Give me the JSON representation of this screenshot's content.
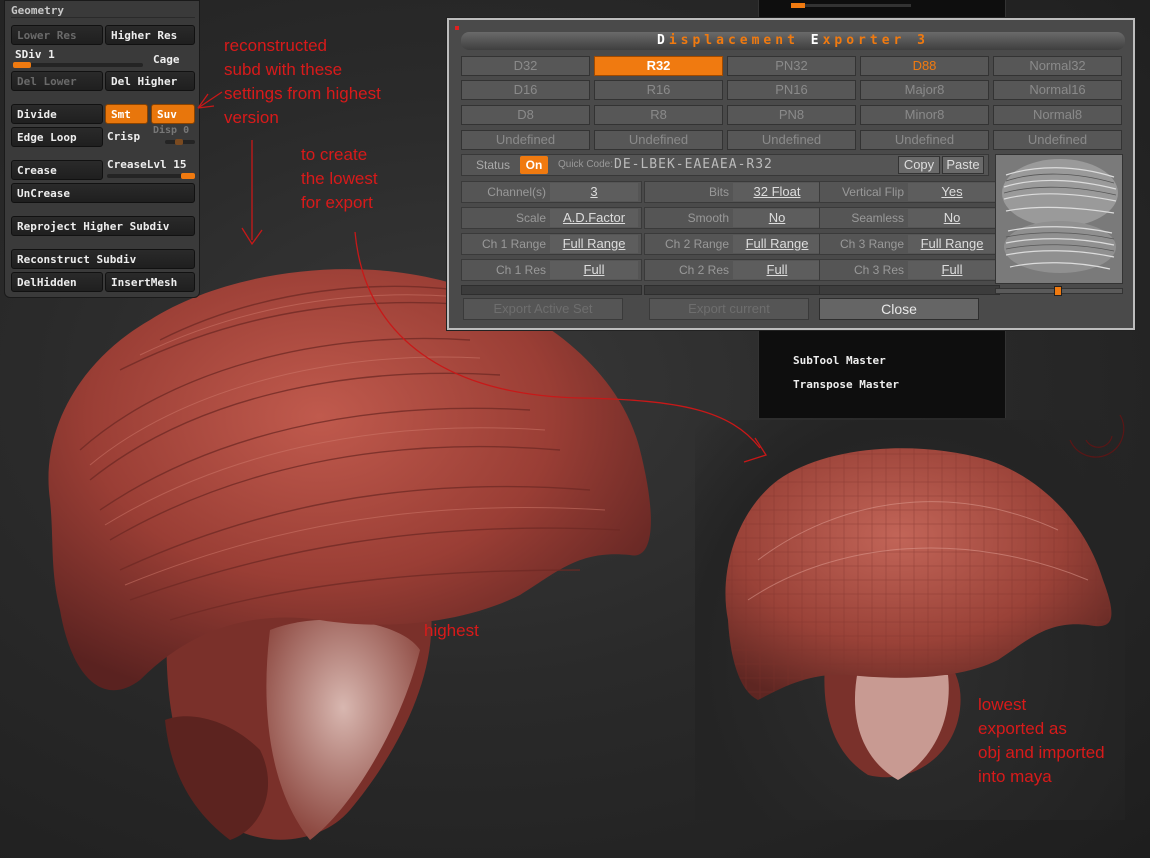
{
  "geometry": {
    "title": "Geometry",
    "lower_res": "Lower Res",
    "higher_res": "Higher Res",
    "sdiv_label": "SDiv 1",
    "cage": "Cage",
    "del_lower": "Del Lower",
    "del_higher": "Del Higher",
    "divide": "Divide",
    "smt": "Smt",
    "suv": "Suv",
    "edge_loop": "Edge Loop",
    "crisp": "Crisp",
    "disp_label": "Disp 0",
    "crease": "Crease",
    "crease_lvl": "CreaseLvl 15",
    "uncrease": "UnCrease",
    "reproject": "Reproject Higher Subdiv",
    "reconstruct": "Reconstruct Subdiv",
    "delhidden": "DelHidden",
    "insertmesh": "InsertMesh"
  },
  "subtool": {
    "items": [
      "SubTool Master",
      "Transpose Master"
    ]
  },
  "exporter": {
    "title_parts": {
      "d": "D",
      "rest1": "isplacement ",
      "e": "E",
      "rest2": "xporter 3"
    },
    "formats": [
      [
        "D32",
        "R32",
        "PN32",
        "D88",
        "Normal32"
      ],
      [
        "D16",
        "R16",
        "PN16",
        "Major8",
        "Normal16"
      ],
      [
        "D8",
        "R8",
        "PN8",
        "Minor8",
        "Normal8"
      ],
      [
        "Undefined",
        "Undefined",
        "Undefined",
        "Undefined",
        "Undefined"
      ]
    ],
    "selected_format": "R32",
    "highlight_format": "D88",
    "status_label": "Status",
    "status_value": "On",
    "quick_code_label": "Quick Code:",
    "quick_code_value": "DE-LBEK-EAEAEA-R32",
    "copy": "Copy",
    "paste": "Paste",
    "params": [
      [
        {
          "label": "Channel(s)",
          "value": "3"
        },
        {
          "label": "Bits",
          "value": "32 Float"
        },
        {
          "label": "Vertical Flip",
          "value": "Yes"
        }
      ],
      [
        {
          "label": "Scale",
          "value": "A.D.Factor"
        },
        {
          "label": "Smooth",
          "value": "No"
        },
        {
          "label": "Seamless",
          "value": "No"
        }
      ],
      [
        {
          "label": "Ch 1 Range",
          "value": "Full Range"
        },
        {
          "label": "Ch 2 Range",
          "value": "Full Range"
        },
        {
          "label": "Ch 3 Range",
          "value": "Full Range"
        }
      ],
      [
        {
          "label": "Ch 1 Res",
          "value": "Full"
        },
        {
          "label": "Ch 2 Res",
          "value": "Full"
        },
        {
          "label": "Ch 3 Res",
          "value": "Full"
        }
      ]
    ],
    "export_active_set": "Export Active Set",
    "export_current": "Export current",
    "close": "Close"
  },
  "annotations": {
    "reconstructed": [
      "reconstructed",
      "subd with these",
      "settings from highest",
      "version"
    ],
    "create_lowest": [
      "to create",
      "the lowest",
      "for export"
    ],
    "highest": "highest",
    "lowest": [
      "lowest",
      "exported as",
      "obj and imported",
      "into maya"
    ]
  },
  "colors": {
    "accent": "#f07a10",
    "annotation": "#d81a1a",
    "mesh": "#a8463c"
  }
}
